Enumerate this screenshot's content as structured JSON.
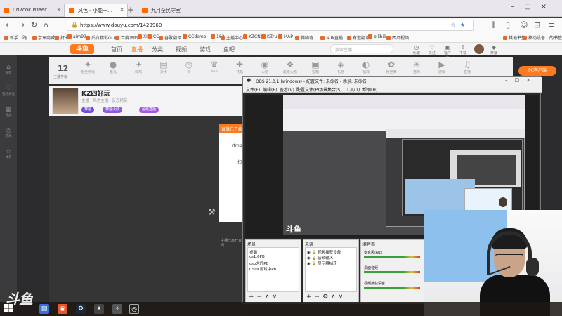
{
  "browser": {
    "tabs": [
      {
        "title": "Список известных хаки карт"
      },
      {
        "title": "风色 - 小能一躲直播_后台精彩"
      },
      {
        "title": "九月全民守室"
      }
    ],
    "url": "https://www.douyu.com/1429960",
    "bookmarks": [
      "新手上路",
      "京东商城",
      "打卡",
      "aim99",
      "后台精彩OUW",
      "百度识图",
      "XI",
      "CC",
      "谷歌翻译",
      "CCdemo",
      "162",
      "主播中心",
      "KZCN",
      "KZru",
      "MAP",
      "斜响奇",
      "斗鱼直播",
      "有道翻译",
      "bilibili",
      "西瓜视频",
      "其他书签",
      "移动设备上的书签"
    ]
  },
  "douyu": {
    "logo": "斗鱼",
    "nav": [
      "首页",
      "直播",
      "分类",
      "视频",
      "游戏",
      "鱼吧"
    ],
    "search_placeholder": "搜索主播",
    "header_icons": [
      {
        "icon": "history-icon",
        "label": "历史"
      },
      {
        "icon": "follow-icon",
        "label": "关注"
      },
      {
        "icon": "gift-icon",
        "label": "客户端"
      },
      {
        "icon": "download-icon",
        "label": "下载"
      },
      {
        "icon": "vip-icon",
        "label": "开播"
      }
    ],
    "left_menu": [
      "推荐",
      "我的关注",
      "分类",
      "游戏",
      "体育"
    ],
    "gift_level": "12",
    "gift_level_label": "主播等级",
    "gifts": [
      "粉丝荧光",
      "鱼丸",
      "弱鸡",
      "办卡",
      "赞",
      "666",
      "飞机",
      "火箭",
      "超级火箭",
      "宝箱",
      "礼物",
      "福袋",
      "粉丝牌",
      "猫咪",
      "游艇",
      "直播"
    ],
    "pc_button": "PC客户端",
    "streamer": {
      "name": "KZ四好玩",
      "meta": "主播 · 风色主播 · 反恐精英",
      "tags": [
        "穿越",
        "穿越火线",
        "超级直播"
      ]
    },
    "video_popup_title": "直播已开始",
    "video_popup_line1": "rtmp",
    "video_popup_line2": "扫",
    "video_caption": "主播已离开直播间"
  },
  "obs": {
    "title": "OBS 21.0.1 (windows) - 配置文件: 未命名 - 场景: 未命名",
    "menu": [
      "文件(F)",
      "编辑(E)",
      "查看(V)",
      "配置文件(P)",
      "场景集合(S)",
      "工具(T)",
      "帮助(H)"
    ],
    "scenes_title": "场景",
    "scenes": [
      "桌面",
      "cs1.6PB",
      "cso大厅PB",
      "CSOL游戏中PB"
    ],
    "sources_title": "来源",
    "sources": [
      "视频捕获设备",
      "音频输入",
      "显示器捕获"
    ],
    "mixer_title": "混音器",
    "mixer": [
      "麦克风/Aux",
      "桌面音频",
      "视频捕获设备"
    ],
    "preview_logo": "斗鱼"
  },
  "taskbar": {
    "watermark": "斗鱼",
    "apps": [
      "windows-icon",
      "explorer-icon",
      "chrome-icon",
      "firefox-icon",
      "steam-icon",
      "cs-icon",
      "csol-icon",
      "obs-icon"
    ]
  },
  "colors": {
    "accent": "#ff7a1e",
    "obs_bg": "#2b2b2b",
    "page_bg": "#2c2c2e"
  }
}
